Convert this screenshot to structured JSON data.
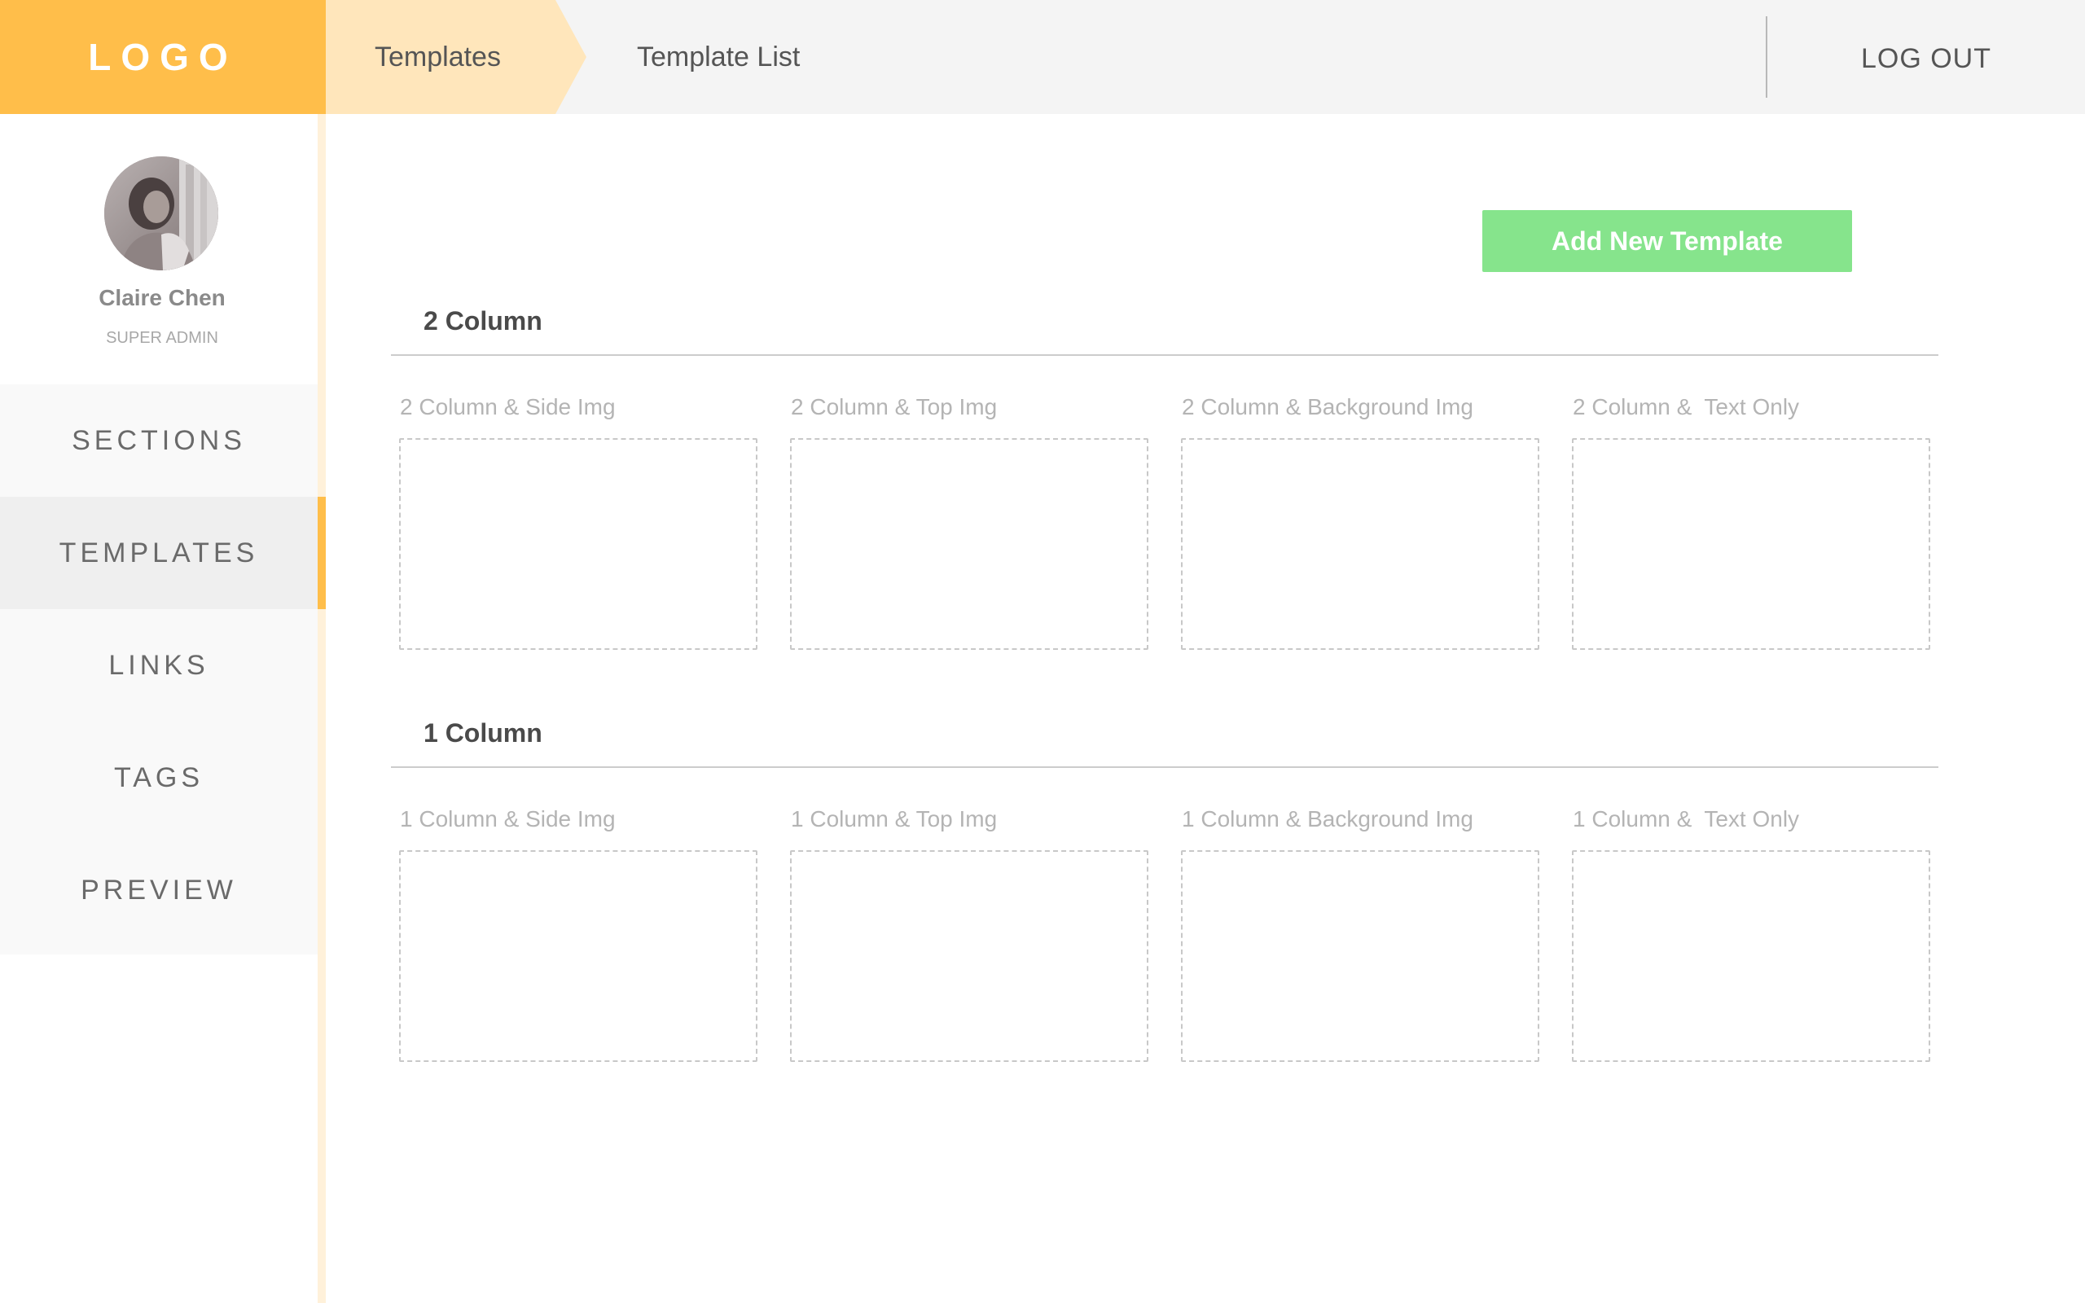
{
  "header": {
    "logo": "LOGO",
    "breadcrumb": [
      "Templates",
      "Template List"
    ],
    "logout_label": "LOG OUT"
  },
  "profile": {
    "name": "Claire Chen",
    "role": "SUPER ADMIN"
  },
  "sidebar": {
    "items": [
      {
        "label": "SECTIONS",
        "active": false
      },
      {
        "label": "TEMPLATES",
        "active": true
      },
      {
        "label": "LINKS",
        "active": false
      },
      {
        "label": "TAGS",
        "active": false
      },
      {
        "label": "PREVIEW",
        "active": false
      }
    ]
  },
  "main": {
    "add_button_label": "Add New Template",
    "sections": [
      {
        "title": "2 Column",
        "templates": [
          {
            "label": "2 Column & Side Img"
          },
          {
            "label": "2 Column & Top Img"
          },
          {
            "label": "2 Column & Background Img"
          },
          {
            "label": "2 Column &  Text Only"
          }
        ]
      },
      {
        "title": "1 Column",
        "templates": [
          {
            "label": "1 Column & Side Img"
          },
          {
            "label": "1 Column & Top Img"
          },
          {
            "label": "1 Column & Background Img"
          },
          {
            "label": "1 Column &  Text Only"
          }
        ]
      }
    ]
  },
  "colors": {
    "accent": "#ffbe4a",
    "accent_light": "#ffe6bb",
    "add_button": "#86e48c",
    "header_bg": "#f4f4f4"
  }
}
